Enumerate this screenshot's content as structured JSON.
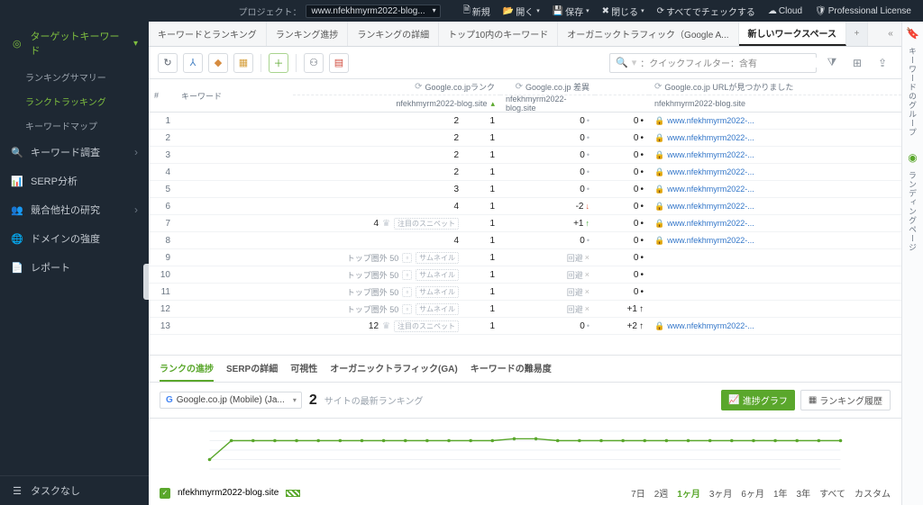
{
  "topbar": {
    "project_label": "プロジェクト：",
    "project_value": "www.nfekhmyrm2022-blog...",
    "new": "新規",
    "open": "開く",
    "save": "保存",
    "close": "閉じる",
    "check_all": "すべてでチェックする",
    "cloud": "Cloud",
    "license": "Professional License"
  },
  "sidebar": {
    "s1": {
      "label": "ターゲットキーワード"
    },
    "s1_sub": [
      "ランキングサマリー",
      "ランクトラッキング",
      "キーワードマップ"
    ],
    "s1_active_index": 1,
    "s2": "キーワード調査",
    "s3": "SERP分析",
    "s4": "競合他社の研究",
    "s5": "ドメインの強度",
    "s6": "レポート",
    "bottom": "タスクなし"
  },
  "tabs": {
    "items": [
      "キーワードとランキング",
      "ランキング進捗",
      "ランキングの詳細",
      "トップ10内のキーワード",
      "オーガニックトラフィック（Google A...",
      "新しいワークスペース"
    ],
    "active_index": 5
  },
  "toolbar": {
    "quick_filter_label": "：クイックフィルター：含有"
  },
  "table": {
    "headers": {
      "idx": "#",
      "keyword": "キーワード",
      "rank_top": "Google.co.jpランク",
      "rank_site": "nfekhmyrm2022-blog.site",
      "diff_top": "Google.co.jp 差異",
      "diff_site": "nfekhmyrm2022-blog.site",
      "url_top": "Google.co.jp URLが見つかりました",
      "url_site": "nfekhmyrm2022-blog.site"
    },
    "snippet_label": "注目のスニペット",
    "thumb_label": "サムネイル",
    "out50_label": "トップ圏外 50",
    "kairi_label": "回避",
    "url_text": "www.nfekhmyrm2022-...",
    "rows": [
      {
        "n": 1,
        "rank": "2",
        "rankB": "1",
        "diff": "0",
        "diffB": "0",
        "url": true
      },
      {
        "n": 2,
        "rank": "2",
        "rankB": "1",
        "diff": "0",
        "diffB": "0",
        "url": true
      },
      {
        "n": 3,
        "rank": "2",
        "rankB": "1",
        "diff": "0",
        "diffB": "0",
        "url": true
      },
      {
        "n": 4,
        "rank": "2",
        "rankB": "1",
        "diff": "0",
        "diffB": "0",
        "url": true
      },
      {
        "n": 5,
        "rank": "3",
        "rankB": "1",
        "diff": "0",
        "diffB": "0",
        "url": true
      },
      {
        "n": 6,
        "rank": "4",
        "rankB": "1",
        "diff": "-2",
        "down": true,
        "diffB": "0",
        "url": true
      },
      {
        "n": 7,
        "rank": "4",
        "crown": true,
        "snippet": true,
        "rankB": "1",
        "diff": "+1",
        "up": true,
        "diffB": "0",
        "url": true
      },
      {
        "n": 8,
        "rank": "4",
        "rankB": "1",
        "diff": "0",
        "diffB": "0",
        "url": true
      },
      {
        "n": 9,
        "out50": true,
        "thumb": true,
        "rankB": "1",
        "kairi": true,
        "diffB": "0"
      },
      {
        "n": 10,
        "out50": true,
        "thumb": true,
        "rankB": "1",
        "kairi": true,
        "diffB": "0"
      },
      {
        "n": 11,
        "out50": true,
        "thumb": true,
        "rankB": "1",
        "kairi": true,
        "diffB": "0"
      },
      {
        "n": 12,
        "out50": true,
        "thumb": true,
        "rankB": "1",
        "kairi": true,
        "diffB": "+1",
        "upB": true
      },
      {
        "n": 13,
        "rank": "12",
        "crown": true,
        "snippet": true,
        "rankB": "1",
        "diff": "0",
        "diffB": "+2",
        "upB": true,
        "url": true
      }
    ]
  },
  "bottom_tabs": {
    "items": [
      "ランクの進捗",
      "SERPの詳細",
      "可視性",
      "オーガニックトラフィック(GA)",
      "キーワードの難易度"
    ],
    "active_index": 0
  },
  "chart_ctrl": {
    "se_label": "Google.co.jp (Mobile) (Ja...",
    "big_num": "2",
    "desc": "サイトの最新ランキング",
    "btn_graph": "進捗グラフ",
    "btn_history": "ランキング履歴"
  },
  "legend": {
    "site": "nfekhmyrm2022-blog.site",
    "ranges": [
      "7日",
      "2週",
      "1ヶ月",
      "3ヶ月",
      "6ヶ月",
      "1年",
      "3年",
      "すべて",
      "カスタム"
    ],
    "active_index": 2
  },
  "rside": {
    "t1": "キーワードのグループ",
    "t2": "ランディングページ"
  },
  "chart_data": {
    "type": "line",
    "title": "",
    "xlabel": "",
    "ylabel": "",
    "ylim": [
      1,
      5
    ],
    "x": [
      0,
      1,
      2,
      3,
      4,
      5,
      6,
      7,
      8,
      9,
      10,
      11,
      12,
      13,
      14,
      15,
      16,
      17,
      18,
      19,
      20,
      21,
      22,
      23,
      24,
      25,
      26,
      27,
      28,
      29
    ],
    "series": [
      {
        "name": "nfekhmyrm2022-blog.site",
        "color": "#5aa72c",
        "values": [
          4,
          2,
          2,
          2,
          2,
          2,
          2,
          2,
          2,
          2,
          2,
          2,
          2,
          2,
          1.8,
          1.8,
          2,
          2,
          2,
          2,
          2,
          2,
          2,
          2,
          2,
          2,
          2,
          2,
          2,
          2
        ]
      }
    ]
  }
}
